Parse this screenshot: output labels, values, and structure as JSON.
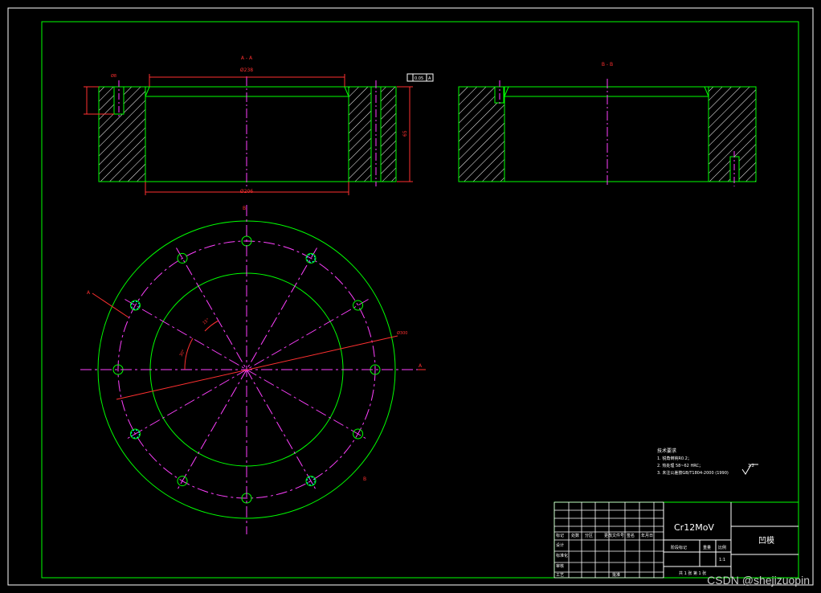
{
  "section_labels": {
    "left_view": "A - A",
    "right_view": "B - B"
  },
  "dimensions": {
    "top_width": "Ø238",
    "bottom_width": "Ø206",
    "small_hole": "Ø8",
    "radius_label": "Ø300",
    "angle_1": "30°",
    "angle_2": "15°",
    "flatness": "0.05",
    "datum": "A",
    "height": "65"
  },
  "markers": {
    "a_left": "A",
    "a_right": "A",
    "b_top": "B",
    "b_bottom": "B"
  },
  "notes": {
    "title": "技术要求",
    "lines": [
      "1. 锐角倒钝R0.2；",
      "2. 热处理 58~62 HRC；",
      "3. 未注公差按GB/T1804-2000 (1990)"
    ],
    "roughness": "3.2"
  },
  "title_block": {
    "material": "Cr12MoV",
    "part_name": "凹模",
    "scale": "1:1",
    "headers": [
      "标记",
      "处数",
      "分区",
      "更改文件号",
      "签名",
      "年月日"
    ],
    "rows": [
      "设计",
      "标准化",
      "审核",
      "工艺",
      "批准"
    ],
    "stage_headers": [
      "阶段标记",
      "重量",
      "比例"
    ],
    "sheet": "共 1 张  第 1 张"
  },
  "watermark": "CSDN @shejizuopin"
}
